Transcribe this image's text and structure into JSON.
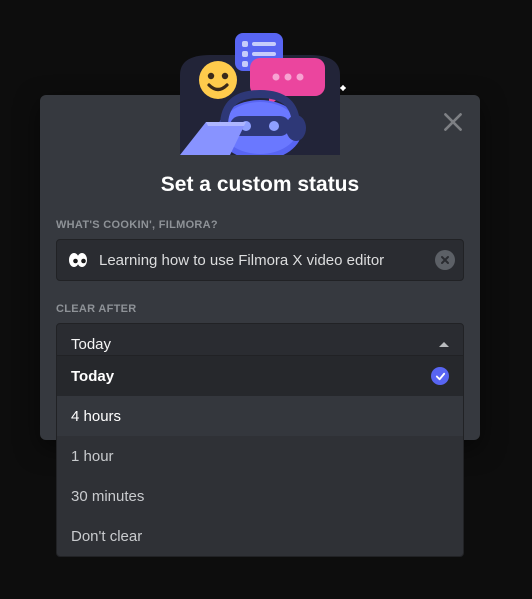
{
  "modal": {
    "title": "Set a custom status",
    "prompt_label": "WHAT'S COOKIN', FILMORA?",
    "status_value": "Learning how to use Filmora X video editor",
    "emoji_icon": "eyes-icon",
    "clear_after_label": "CLEAR AFTER",
    "clear_after_selected": "Today",
    "clear_after_options": [
      {
        "label": "Today",
        "selected": true
      },
      {
        "label": "4 hours",
        "selected": false
      },
      {
        "label": "1 hour",
        "selected": false
      },
      {
        "label": "30 minutes",
        "selected": false
      },
      {
        "label": "Don't clear",
        "selected": false
      }
    ]
  },
  "colors": {
    "background": "#0d0d0d",
    "modal_bg": "#36393f",
    "input_bg": "#2a2c31",
    "dropdown_bg": "#2f3136",
    "accent": "#5865f2",
    "text_muted": "#8e9297",
    "text": "#dcddde"
  }
}
